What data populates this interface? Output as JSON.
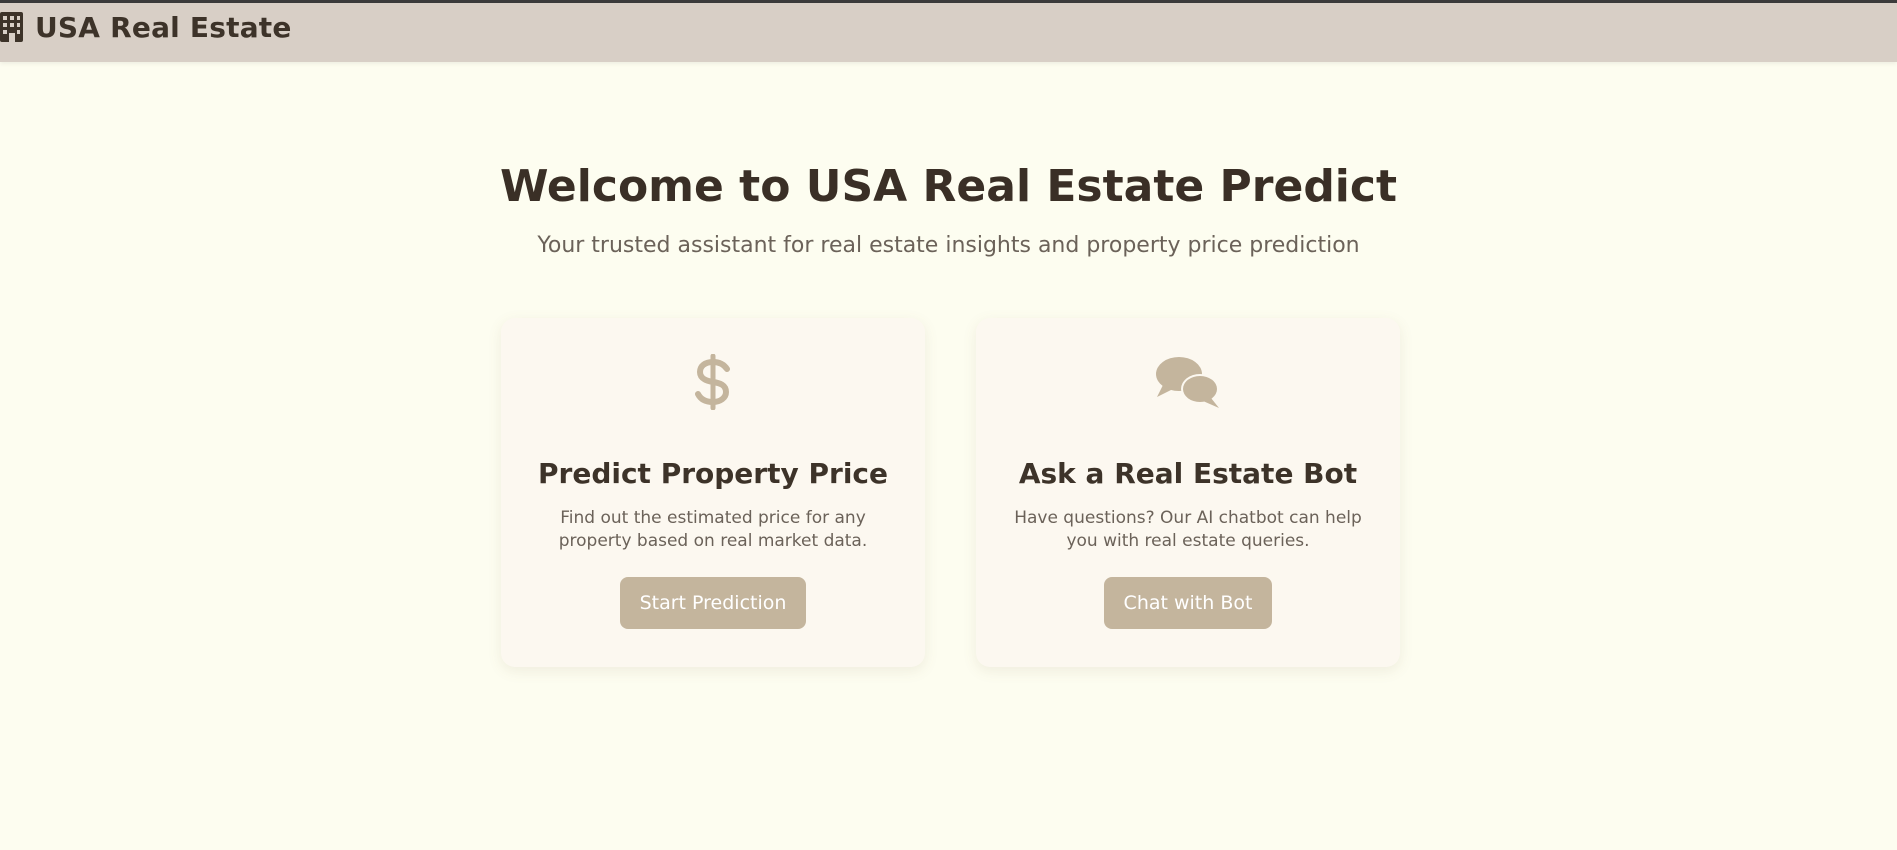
{
  "navbar": {
    "brand_icon": "building-icon",
    "brand_text": "USA Real Estate"
  },
  "hero": {
    "title": "Welcome to USA Real Estate Predict",
    "subtitle": "Your trusted assistant for real estate insights and property price prediction"
  },
  "cards": [
    {
      "icon": "dollar-icon",
      "title": "Predict Property Price",
      "description": "Find out the estimated price for any property based on real market data.",
      "button_label": "Start Prediction"
    },
    {
      "icon": "chat-bubbles-icon",
      "title": "Ask a Real Estate Bot",
      "description": "Have questions? Our AI chatbot can help you with real estate queries.",
      "button_label": "Chat with Bot"
    }
  ],
  "colors": {
    "page_background": "#fdfdf0",
    "navbar_background": "#d8cfc6",
    "card_background": "#fcf8f0",
    "accent": "#c4b59d",
    "heading_text": "#3a2f26",
    "body_text": "#6b6259"
  }
}
